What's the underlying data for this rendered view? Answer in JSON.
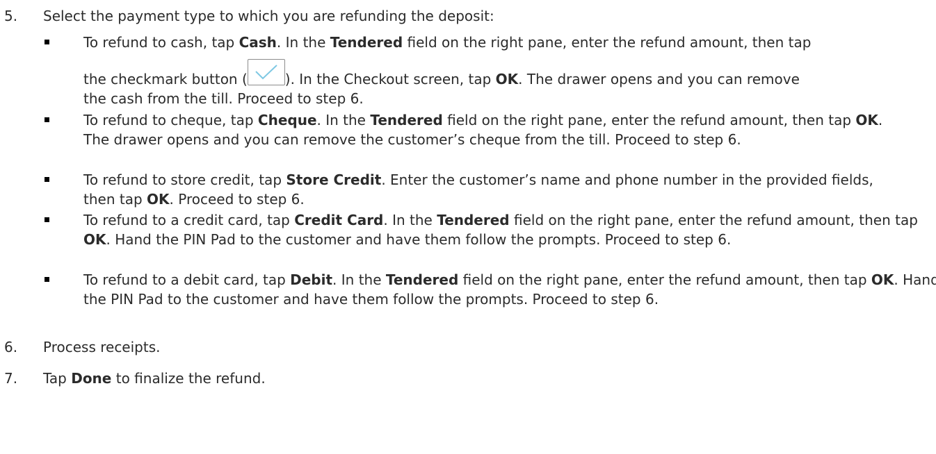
{
  "step5": {
    "num": "5.",
    "text": "Select the payment type to which you are refunding the deposit:"
  },
  "bullets": [
    {
      "segments": [
        {
          "t": "To refund to cash, tap ",
          "b": false
        },
        {
          "t": "Cash",
          "b": true
        },
        {
          "t": ". In the ",
          "b": false
        },
        {
          "t": "Tendered",
          "b": true
        },
        {
          "t": " field on the right pane, enter the refund amount, then tap",
          "b": false
        }
      ],
      "line2_before": "the checkmark button (",
      "line2_after": "). In the Checkout screen, tap ",
      "line2_bold": "OK",
      "line2_end": ". The drawer opens and you can remove",
      "line3": "the cash from the till. Proceed to step 6."
    },
    {
      "segments": [
        {
          "t": "To refund to cheque, tap ",
          "b": false
        },
        {
          "t": "Cheque",
          "b": true
        },
        {
          "t": ". In the ",
          "b": false
        },
        {
          "t": "Tendered",
          "b": true
        },
        {
          "t": " field on the right pane, enter the refund amount, then tap ",
          "b": false
        },
        {
          "t": "OK",
          "b": true
        },
        {
          "t": ". The drawer opens and you can remove the customer’s cheque from the till. Proceed to step 6.",
          "b": false
        }
      ]
    },
    {
      "segments": [
        {
          "t": "To refund to store credit, tap ",
          "b": false
        },
        {
          "t": "Store Credit",
          "b": true
        },
        {
          "t": ". Enter the customer’s name and phone number in the provided fields, then tap ",
          "b": false
        },
        {
          "t": "OK",
          "b": true
        },
        {
          "t": ". Proceed to step 6.",
          "b": false
        }
      ]
    },
    {
      "segments": [
        {
          "t": "To refund to a credit card, tap ",
          "b": false
        },
        {
          "t": "Credit Card",
          "b": true
        },
        {
          "t": ". In the ",
          "b": false
        },
        {
          "t": "Tendered",
          "b": true
        },
        {
          "t": " field on the right pane, enter the refund amount, then tap ",
          "b": false
        },
        {
          "t": "OK",
          "b": true
        },
        {
          "t": ". Hand the PIN Pad to the customer and have them follow the prompts. Proceed to step 6.",
          "b": false
        }
      ]
    },
    {
      "segments": [
        {
          "t": "To refund to a debit card, tap ",
          "b": false
        },
        {
          "t": "Debit",
          "b": true
        },
        {
          "t": ". In the ",
          "b": false
        },
        {
          "t": "Tendered",
          "b": true
        },
        {
          "t": " field on the right pane, enter the refund amount, then tap ",
          "b": false
        },
        {
          "t": "OK",
          "b": true
        },
        {
          "t": ". Hand the PIN Pad to the customer and have them follow the prompts. Proceed to step 6.",
          "b": false
        }
      ]
    }
  ],
  "step6": {
    "num": "6.",
    "text": "Process receipts."
  },
  "step7": {
    "num": "7.",
    "before": "Tap ",
    "bold": "Done",
    "after": " to finalize the refund."
  },
  "checkmark_color": "#7ec8e3",
  "icons": {
    "checkmark": "checkmark-icon",
    "bullet": "square-bullet"
  }
}
